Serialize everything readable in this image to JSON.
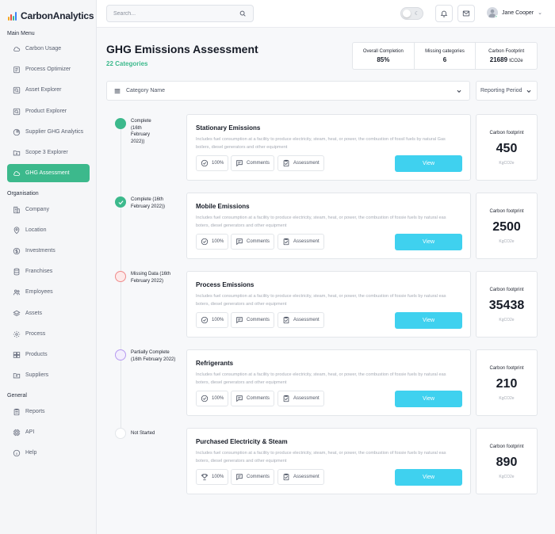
{
  "app": {
    "name": "CarbonAnalytics"
  },
  "sidebar": {
    "main_menu_title": "Main Menu",
    "organisation_title": "Organisation",
    "general_title": "General",
    "main_items": [
      {
        "label": "Carbon Usage",
        "icon": "cloud-icon"
      },
      {
        "label": "Process Optimizer",
        "icon": "process-icon"
      },
      {
        "label": "Asset Explorer",
        "icon": "search-asset-icon"
      },
      {
        "label": "Product Explorer",
        "icon": "product-search-icon"
      },
      {
        "label": "Supplier GHG Analytics",
        "icon": "pie-chart-icon"
      },
      {
        "label": "Scope 3 Explorer",
        "icon": "folder-icon"
      },
      {
        "label": "GHG Assessment",
        "icon": "cloud-icon"
      }
    ],
    "org_items": [
      {
        "label": "Company"
      },
      {
        "label": "Location"
      },
      {
        "label": "Investments"
      },
      {
        "label": "Franchises"
      },
      {
        "label": "Employees"
      },
      {
        "label": "Assets"
      },
      {
        "label": "Process"
      },
      {
        "label": "Products"
      },
      {
        "label": "Suppliers"
      }
    ],
    "general_items": [
      {
        "label": "Reports"
      },
      {
        "label": "API"
      },
      {
        "label": "Help"
      }
    ],
    "active_item": "GHG Assessment"
  },
  "topbar": {
    "search_placeholder": "Search...",
    "user_name": "Jane Cooper"
  },
  "header": {
    "title": "GHG Emissions Assessment",
    "subtitle": "22 Categories"
  },
  "stats": [
    {
      "label": "Overall Completion",
      "value": "85%"
    },
    {
      "label": "Missing categories",
      "value": "6"
    },
    {
      "label": "Carbon Footprint",
      "value": "21689",
      "unit": "tCO2e"
    }
  ],
  "filters": {
    "category_label": "Category Name",
    "period_label": "Reporting Period"
  },
  "categories": [
    {
      "status": "Complete (16th February 2022))",
      "status_color": "#3cb98c",
      "title": "Stationary Emissions",
      "description": "Includes fuel consumption at a facility to produce electricity, steam, heat, or power, the combustion of fossil fuels by natural Gas boilers, diesel generators and other equipment",
      "completion": "100%",
      "comments_label": "Comments",
      "assessment_label": "Assessment",
      "view_label": "View",
      "footprint_label": "Carbon footprint",
      "footprint_value": "450",
      "footprint_unit": "KgCO2e"
    },
    {
      "status": "Complete (16th February 2022))",
      "status_color": "#3cb98c",
      "title": "Mobile Emissions",
      "description": "Includes fuel consumption at a facility to produce electricity, steam, heat, or power, the combustion of fossie fuels by natural eas boters, diesel generators and other equipment",
      "completion": "100%",
      "comments_label": "Comments",
      "assessment_label": "Assessment",
      "view_label": "View",
      "footprint_label": "Carbon footprint",
      "footprint_value": "2500",
      "footprint_unit": "KgCO2e"
    },
    {
      "status": "Missing Data (16th February 2022)",
      "status_color": "#f08a8a",
      "title": "Process Emissions",
      "description": "Includes fuel consumption at a facility to produce electricity, steam, heat, or power, the combustion of fossie fuels by natural eas boters, diesel generators and other equipment",
      "completion": "100%",
      "comments_label": "Comments",
      "assessment_label": "Assessment",
      "view_label": "View",
      "footprint_label": "Carbon footprint",
      "footprint_value": "35438",
      "footprint_unit": "KgCO2e"
    },
    {
      "status": "Partially Complete (16th February 2022)",
      "status_color": "#b69af0",
      "title": "Refrigerants",
      "description": "Includes fuel consumption at a facility to produce electricity, steam, heat, or power, the combustion of fossie fuels by natural eas boters, diesel generators and other equipment",
      "completion": "100%",
      "comments_label": "Comments",
      "assessment_label": "Assessment",
      "view_label": "View",
      "footprint_label": "Carbon footprint",
      "footprint_value": "210",
      "footprint_unit": "KgCO2e"
    },
    {
      "status": "Not Started",
      "status_color": "#e3e6ea",
      "title": "Purchased Electricity & Steam",
      "description": "Includes fuel consumption at a facility to produce electricity, steam, heat, or power, the combustion of fossie fuels by natural eas boters, diesel generators and other equipment",
      "completion": "100%",
      "comments_label": "Comments",
      "assessment_label": "Assessment",
      "view_label": "View",
      "footprint_label": "Carbon footprint",
      "footprint_value": "890",
      "footprint_unit": "KgCO2e"
    }
  ]
}
